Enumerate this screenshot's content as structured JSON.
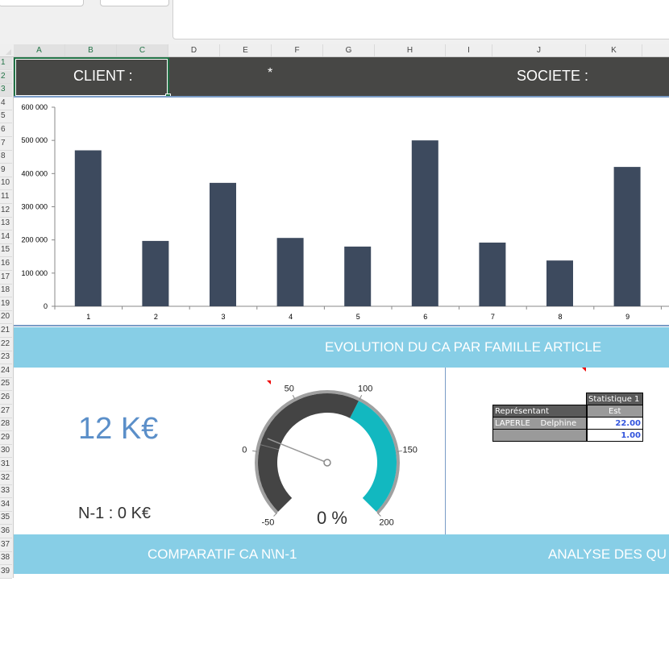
{
  "columns": [
    "A",
    "B",
    "C",
    "D",
    "E",
    "F",
    "G",
    "H",
    "I",
    "J",
    "K"
  ],
  "rows": [
    "1",
    "2",
    "3",
    "4",
    "5",
    "6",
    "7",
    "8",
    "9",
    "10",
    "11",
    "12",
    "13",
    "14",
    "15",
    "16",
    "17",
    "18",
    "19",
    "20",
    "21",
    "22",
    "23",
    "24",
    "25",
    "26",
    "27",
    "28",
    "29",
    "30",
    "31",
    "32",
    "33",
    "34",
    "35",
    "36",
    "37",
    "38",
    "39"
  ],
  "header": {
    "client_label": "CLIENT :",
    "asterisk": "*",
    "societe_label": "SOCIETE :"
  },
  "colors": {
    "header_bg": "#474745",
    "band_bg": "#87cee6",
    "bar": "#3d4a5e",
    "gauge_dark": "#444444",
    "gauge_accent": "#12b8c0",
    "kpi_text": "#5b8fc9",
    "selection": "#217346"
  },
  "chart_data": {
    "type": "bar",
    "title": "",
    "xlabel": "",
    "ylabel": "",
    "categories": [
      "1",
      "2",
      "3",
      "4",
      "5",
      "6",
      "7",
      "8",
      "9"
    ],
    "values": [
      470000,
      197000,
      372000,
      206000,
      180000,
      500000,
      192000,
      138000,
      420000
    ],
    "ylim": [
      0,
      600000
    ],
    "yticks": [
      0,
      100000,
      200000,
      300000,
      400000,
      500000,
      600000
    ],
    "ytick_labels": [
      "0",
      "100 000",
      "200 000",
      "300 000",
      "400 000",
      "500 000",
      "600 000"
    ],
    "grid": false,
    "legend": "none"
  },
  "bands": {
    "evolution": "EVOLUTION DU CA PAR FAMILLE ARTICLE",
    "comparatif": "COMPARATIF CA N\\N-1",
    "analyse": "ANALYSE DES QU"
  },
  "kpi": {
    "value": "12 K€",
    "previous": "N-1 : 0 K€"
  },
  "gauge": {
    "min": -50,
    "max": 200,
    "ticks": [
      "-50",
      "0",
      "50",
      "100",
      "150",
      "200"
    ],
    "tick_values": [
      -50,
      0,
      50,
      100,
      150,
      200
    ],
    "accent_from": 100,
    "accent_to": 200,
    "needle_value": 12,
    "readout": "0 %"
  },
  "stats_table": {
    "title": "Statistique 1",
    "header_label": "Représentant",
    "header_value": "Est",
    "rows": [
      {
        "name": "LAPERLE    Delphine",
        "value": "22.00"
      },
      {
        "name": "",
        "value": "1.00"
      }
    ]
  }
}
